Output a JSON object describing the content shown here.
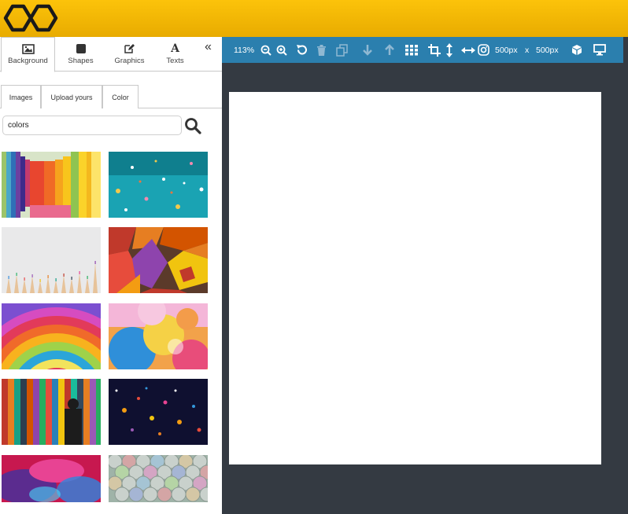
{
  "header": {
    "logo_icon": "hexagon-chain-logo",
    "brand_color": "#f5b800"
  },
  "panel": {
    "tabs": [
      {
        "label": "Background",
        "icon": "image-icon",
        "active": true
      },
      {
        "label": "Shapes",
        "icon": "square-icon",
        "active": false
      },
      {
        "label": "Graphics",
        "icon": "edit-icon",
        "active": false
      },
      {
        "label": "Texts",
        "icon": "text-icon",
        "glyph": "A",
        "active": false
      }
    ],
    "collapse_label": "«",
    "subtabs": [
      {
        "label": "Images",
        "active": true
      },
      {
        "label": "Upload yours",
        "active": false
      },
      {
        "label": "Color",
        "active": false
      }
    ],
    "search": {
      "value": "colors"
    },
    "results_count": 10
  },
  "toolbar": {
    "zoom": "113%",
    "width_text": "500px",
    "x_text": "x",
    "height_text": "500px",
    "icons": [
      "zoom-out-icon",
      "zoom-in-icon",
      "undo-icon",
      "trash-icon",
      "duplicate-icon",
      "move-down-icon",
      "move-up-icon",
      "grid-icon",
      "crop-icon",
      "vertical-flip-icon",
      "horizontal-flip-icon",
      "instagram-icon",
      "cube-icon",
      "monitor-icon"
    ],
    "accent_color": "#2b7fae"
  },
  "workspace": {
    "background_color": "#343a42",
    "canvas_color": "#ffffff"
  }
}
